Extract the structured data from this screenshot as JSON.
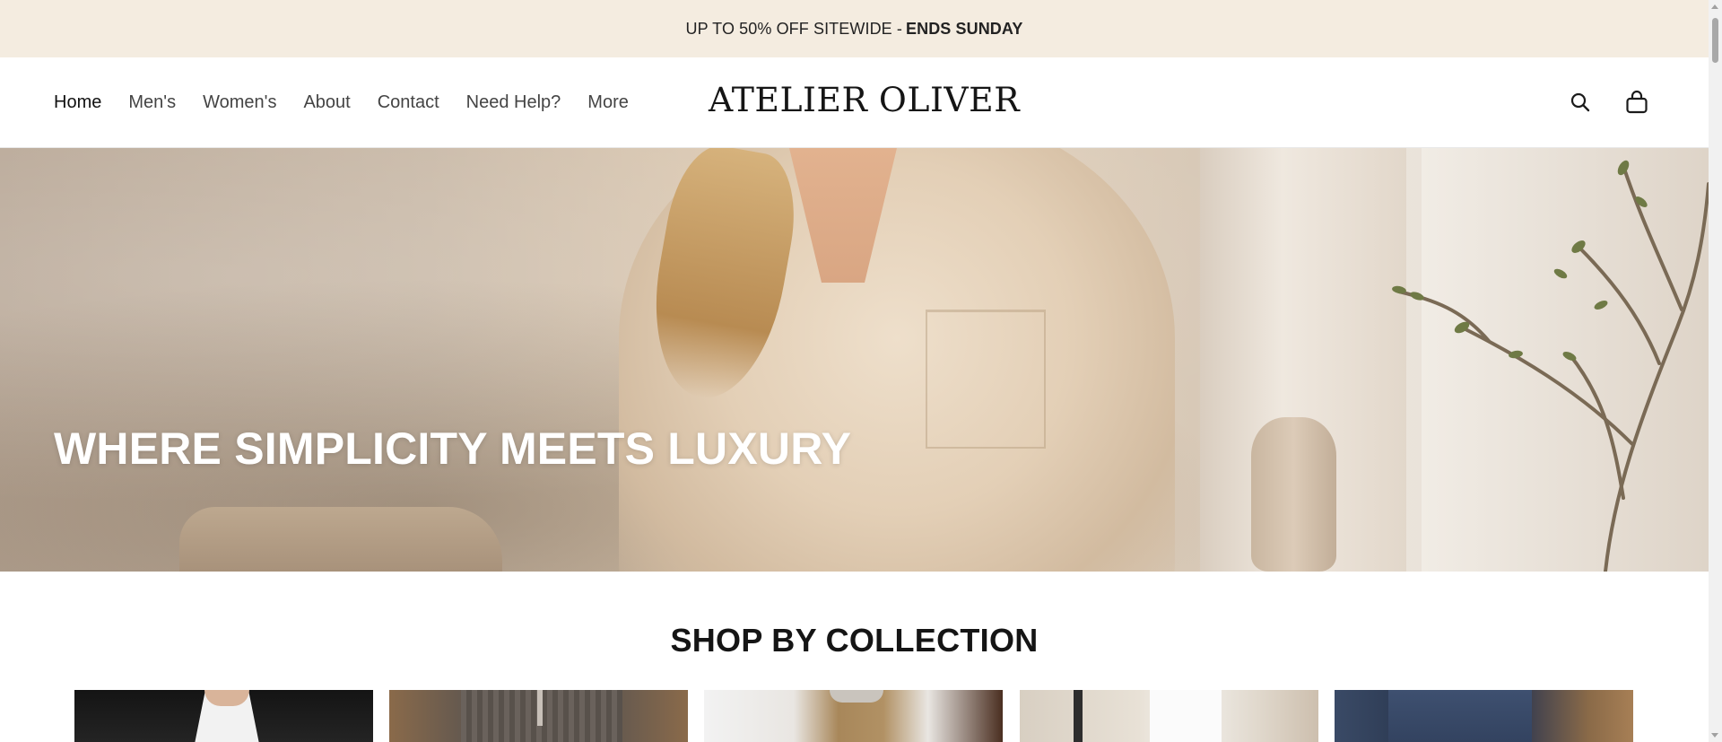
{
  "announcement": {
    "text": "UP TO 50% OFF SITEWIDE -",
    "emphasis": "ENDS SUNDAY",
    "background_color": "#f4ece0"
  },
  "header": {
    "nav_items": [
      {
        "label": "Home",
        "active": true
      },
      {
        "label": "Men's",
        "active": false
      },
      {
        "label": "Women's",
        "active": false
      },
      {
        "label": "About",
        "active": false
      },
      {
        "label": "Contact",
        "active": false
      },
      {
        "label": "Need Help?",
        "active": false
      },
      {
        "label": "More",
        "active": false
      }
    ],
    "logo": "ATELIER OLIVER",
    "icons": {
      "search": "search-icon",
      "cart": "shopping-bag-icon"
    }
  },
  "hero": {
    "title": "WHERE SIMPLICITY MEETS LUXURY",
    "title_color": "#ffffff"
  },
  "collections": {
    "title": "SHOP BY COLLECTION",
    "cards": [
      {
        "name": "collection-card-1"
      },
      {
        "name": "collection-card-2"
      },
      {
        "name": "collection-card-3"
      },
      {
        "name": "collection-card-4"
      },
      {
        "name": "collection-card-5"
      }
    ]
  }
}
